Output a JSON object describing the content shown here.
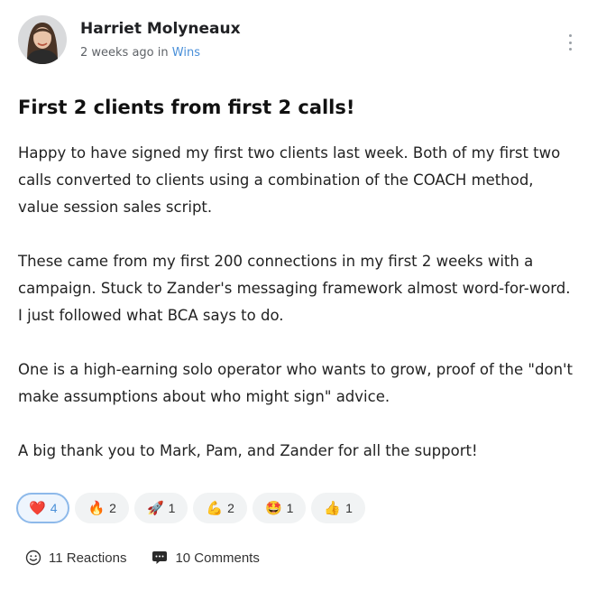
{
  "author": {
    "name": "Harriet Molyneaux",
    "time_ago": "2 weeks ago",
    "in_word": "in",
    "category": "Wins"
  },
  "post": {
    "title": "First 2 clients from first 2 calls!",
    "paragraphs": [
      "Happy to have signed my first two clients last week. Both of my first two calls converted to clients using a combination of the COACH method, value session sales script.",
      "These came from my first 200 connections in my first 2 weeks with a campaign. Stuck to Zander's messaging framework almost word-for-word. I just followed what BCA says to do.",
      "One is a high-earning solo operator who wants to grow, proof of the \"don't make assumptions about who might sign\" advice.",
      "A big thank you to Mark, Pam, and Zander for all the support!"
    ]
  },
  "reactions": [
    {
      "emoji": "❤️",
      "icon": "heart-icon",
      "count": "4",
      "active": true
    },
    {
      "emoji": "🔥",
      "icon": "fire-icon",
      "count": "2",
      "active": false
    },
    {
      "emoji": "🚀",
      "icon": "rocket-icon",
      "count": "1",
      "active": false
    },
    {
      "emoji": "💪",
      "icon": "flexed-biceps-icon",
      "count": "2",
      "active": false
    },
    {
      "emoji": "🤩",
      "icon": "star-struck-icon",
      "count": "1",
      "active": false
    },
    {
      "emoji": "👍",
      "icon": "thumbs-up-icon",
      "count": "1",
      "active": false
    }
  ],
  "footer": {
    "reactions_label": "11 Reactions",
    "comments_label": "10 Comments"
  },
  "colors": {
    "accent": "#4a90d9",
    "active_reaction_border": "#8db9ea",
    "reaction_bg": "#f1f3f4"
  }
}
